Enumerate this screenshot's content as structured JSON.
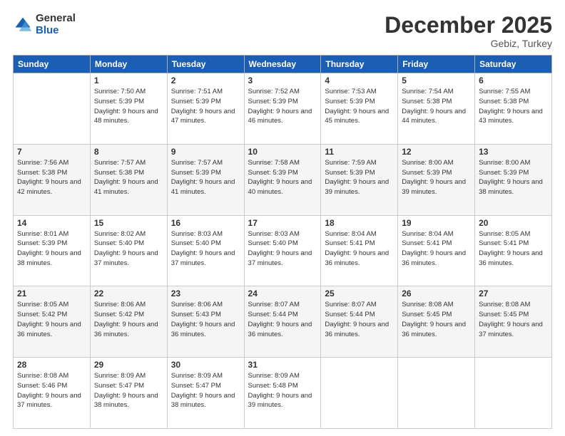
{
  "header": {
    "logo_general": "General",
    "logo_blue": "Blue",
    "month_title": "December 2025",
    "location": "Gebiz, Turkey"
  },
  "days_of_week": [
    "Sunday",
    "Monday",
    "Tuesday",
    "Wednesday",
    "Thursday",
    "Friday",
    "Saturday"
  ],
  "weeks": [
    [
      {
        "day": "",
        "sunrise": "",
        "sunset": "",
        "daylight": ""
      },
      {
        "day": "1",
        "sunrise": "Sunrise: 7:50 AM",
        "sunset": "Sunset: 5:39 PM",
        "daylight": "Daylight: 9 hours and 48 minutes."
      },
      {
        "day": "2",
        "sunrise": "Sunrise: 7:51 AM",
        "sunset": "Sunset: 5:39 PM",
        "daylight": "Daylight: 9 hours and 47 minutes."
      },
      {
        "day": "3",
        "sunrise": "Sunrise: 7:52 AM",
        "sunset": "Sunset: 5:39 PM",
        "daylight": "Daylight: 9 hours and 46 minutes."
      },
      {
        "day": "4",
        "sunrise": "Sunrise: 7:53 AM",
        "sunset": "Sunset: 5:39 PM",
        "daylight": "Daylight: 9 hours and 45 minutes."
      },
      {
        "day": "5",
        "sunrise": "Sunrise: 7:54 AM",
        "sunset": "Sunset: 5:38 PM",
        "daylight": "Daylight: 9 hours and 44 minutes."
      },
      {
        "day": "6",
        "sunrise": "Sunrise: 7:55 AM",
        "sunset": "Sunset: 5:38 PM",
        "daylight": "Daylight: 9 hours and 43 minutes."
      }
    ],
    [
      {
        "day": "7",
        "sunrise": "Sunrise: 7:56 AM",
        "sunset": "Sunset: 5:38 PM",
        "daylight": "Daylight: 9 hours and 42 minutes."
      },
      {
        "day": "8",
        "sunrise": "Sunrise: 7:57 AM",
        "sunset": "Sunset: 5:38 PM",
        "daylight": "Daylight: 9 hours and 41 minutes."
      },
      {
        "day": "9",
        "sunrise": "Sunrise: 7:57 AM",
        "sunset": "Sunset: 5:39 PM",
        "daylight": "Daylight: 9 hours and 41 minutes."
      },
      {
        "day": "10",
        "sunrise": "Sunrise: 7:58 AM",
        "sunset": "Sunset: 5:39 PM",
        "daylight": "Daylight: 9 hours and 40 minutes."
      },
      {
        "day": "11",
        "sunrise": "Sunrise: 7:59 AM",
        "sunset": "Sunset: 5:39 PM",
        "daylight": "Daylight: 9 hours and 39 minutes."
      },
      {
        "day": "12",
        "sunrise": "Sunrise: 8:00 AM",
        "sunset": "Sunset: 5:39 PM",
        "daylight": "Daylight: 9 hours and 39 minutes."
      },
      {
        "day": "13",
        "sunrise": "Sunrise: 8:00 AM",
        "sunset": "Sunset: 5:39 PM",
        "daylight": "Daylight: 9 hours and 38 minutes."
      }
    ],
    [
      {
        "day": "14",
        "sunrise": "Sunrise: 8:01 AM",
        "sunset": "Sunset: 5:39 PM",
        "daylight": "Daylight: 9 hours and 38 minutes."
      },
      {
        "day": "15",
        "sunrise": "Sunrise: 8:02 AM",
        "sunset": "Sunset: 5:40 PM",
        "daylight": "Daylight: 9 hours and 37 minutes."
      },
      {
        "day": "16",
        "sunrise": "Sunrise: 8:03 AM",
        "sunset": "Sunset: 5:40 PM",
        "daylight": "Daylight: 9 hours and 37 minutes."
      },
      {
        "day": "17",
        "sunrise": "Sunrise: 8:03 AM",
        "sunset": "Sunset: 5:40 PM",
        "daylight": "Daylight: 9 hours and 37 minutes."
      },
      {
        "day": "18",
        "sunrise": "Sunrise: 8:04 AM",
        "sunset": "Sunset: 5:41 PM",
        "daylight": "Daylight: 9 hours and 36 minutes."
      },
      {
        "day": "19",
        "sunrise": "Sunrise: 8:04 AM",
        "sunset": "Sunset: 5:41 PM",
        "daylight": "Daylight: 9 hours and 36 minutes."
      },
      {
        "day": "20",
        "sunrise": "Sunrise: 8:05 AM",
        "sunset": "Sunset: 5:41 PM",
        "daylight": "Daylight: 9 hours and 36 minutes."
      }
    ],
    [
      {
        "day": "21",
        "sunrise": "Sunrise: 8:05 AM",
        "sunset": "Sunset: 5:42 PM",
        "daylight": "Daylight: 9 hours and 36 minutes."
      },
      {
        "day": "22",
        "sunrise": "Sunrise: 8:06 AM",
        "sunset": "Sunset: 5:42 PM",
        "daylight": "Daylight: 9 hours and 36 minutes."
      },
      {
        "day": "23",
        "sunrise": "Sunrise: 8:06 AM",
        "sunset": "Sunset: 5:43 PM",
        "daylight": "Daylight: 9 hours and 36 minutes."
      },
      {
        "day": "24",
        "sunrise": "Sunrise: 8:07 AM",
        "sunset": "Sunset: 5:44 PM",
        "daylight": "Daylight: 9 hours and 36 minutes."
      },
      {
        "day": "25",
        "sunrise": "Sunrise: 8:07 AM",
        "sunset": "Sunset: 5:44 PM",
        "daylight": "Daylight: 9 hours and 36 minutes."
      },
      {
        "day": "26",
        "sunrise": "Sunrise: 8:08 AM",
        "sunset": "Sunset: 5:45 PM",
        "daylight": "Daylight: 9 hours and 36 minutes."
      },
      {
        "day": "27",
        "sunrise": "Sunrise: 8:08 AM",
        "sunset": "Sunset: 5:45 PM",
        "daylight": "Daylight: 9 hours and 37 minutes."
      }
    ],
    [
      {
        "day": "28",
        "sunrise": "Sunrise: 8:08 AM",
        "sunset": "Sunset: 5:46 PM",
        "daylight": "Daylight: 9 hours and 37 minutes."
      },
      {
        "day": "29",
        "sunrise": "Sunrise: 8:09 AM",
        "sunset": "Sunset: 5:47 PM",
        "daylight": "Daylight: 9 hours and 38 minutes."
      },
      {
        "day": "30",
        "sunrise": "Sunrise: 8:09 AM",
        "sunset": "Sunset: 5:47 PM",
        "daylight": "Daylight: 9 hours and 38 minutes."
      },
      {
        "day": "31",
        "sunrise": "Sunrise: 8:09 AM",
        "sunset": "Sunset: 5:48 PM",
        "daylight": "Daylight: 9 hours and 39 minutes."
      },
      {
        "day": "",
        "sunrise": "",
        "sunset": "",
        "daylight": ""
      },
      {
        "day": "",
        "sunrise": "",
        "sunset": "",
        "daylight": ""
      },
      {
        "day": "",
        "sunrise": "",
        "sunset": "",
        "daylight": ""
      }
    ]
  ]
}
